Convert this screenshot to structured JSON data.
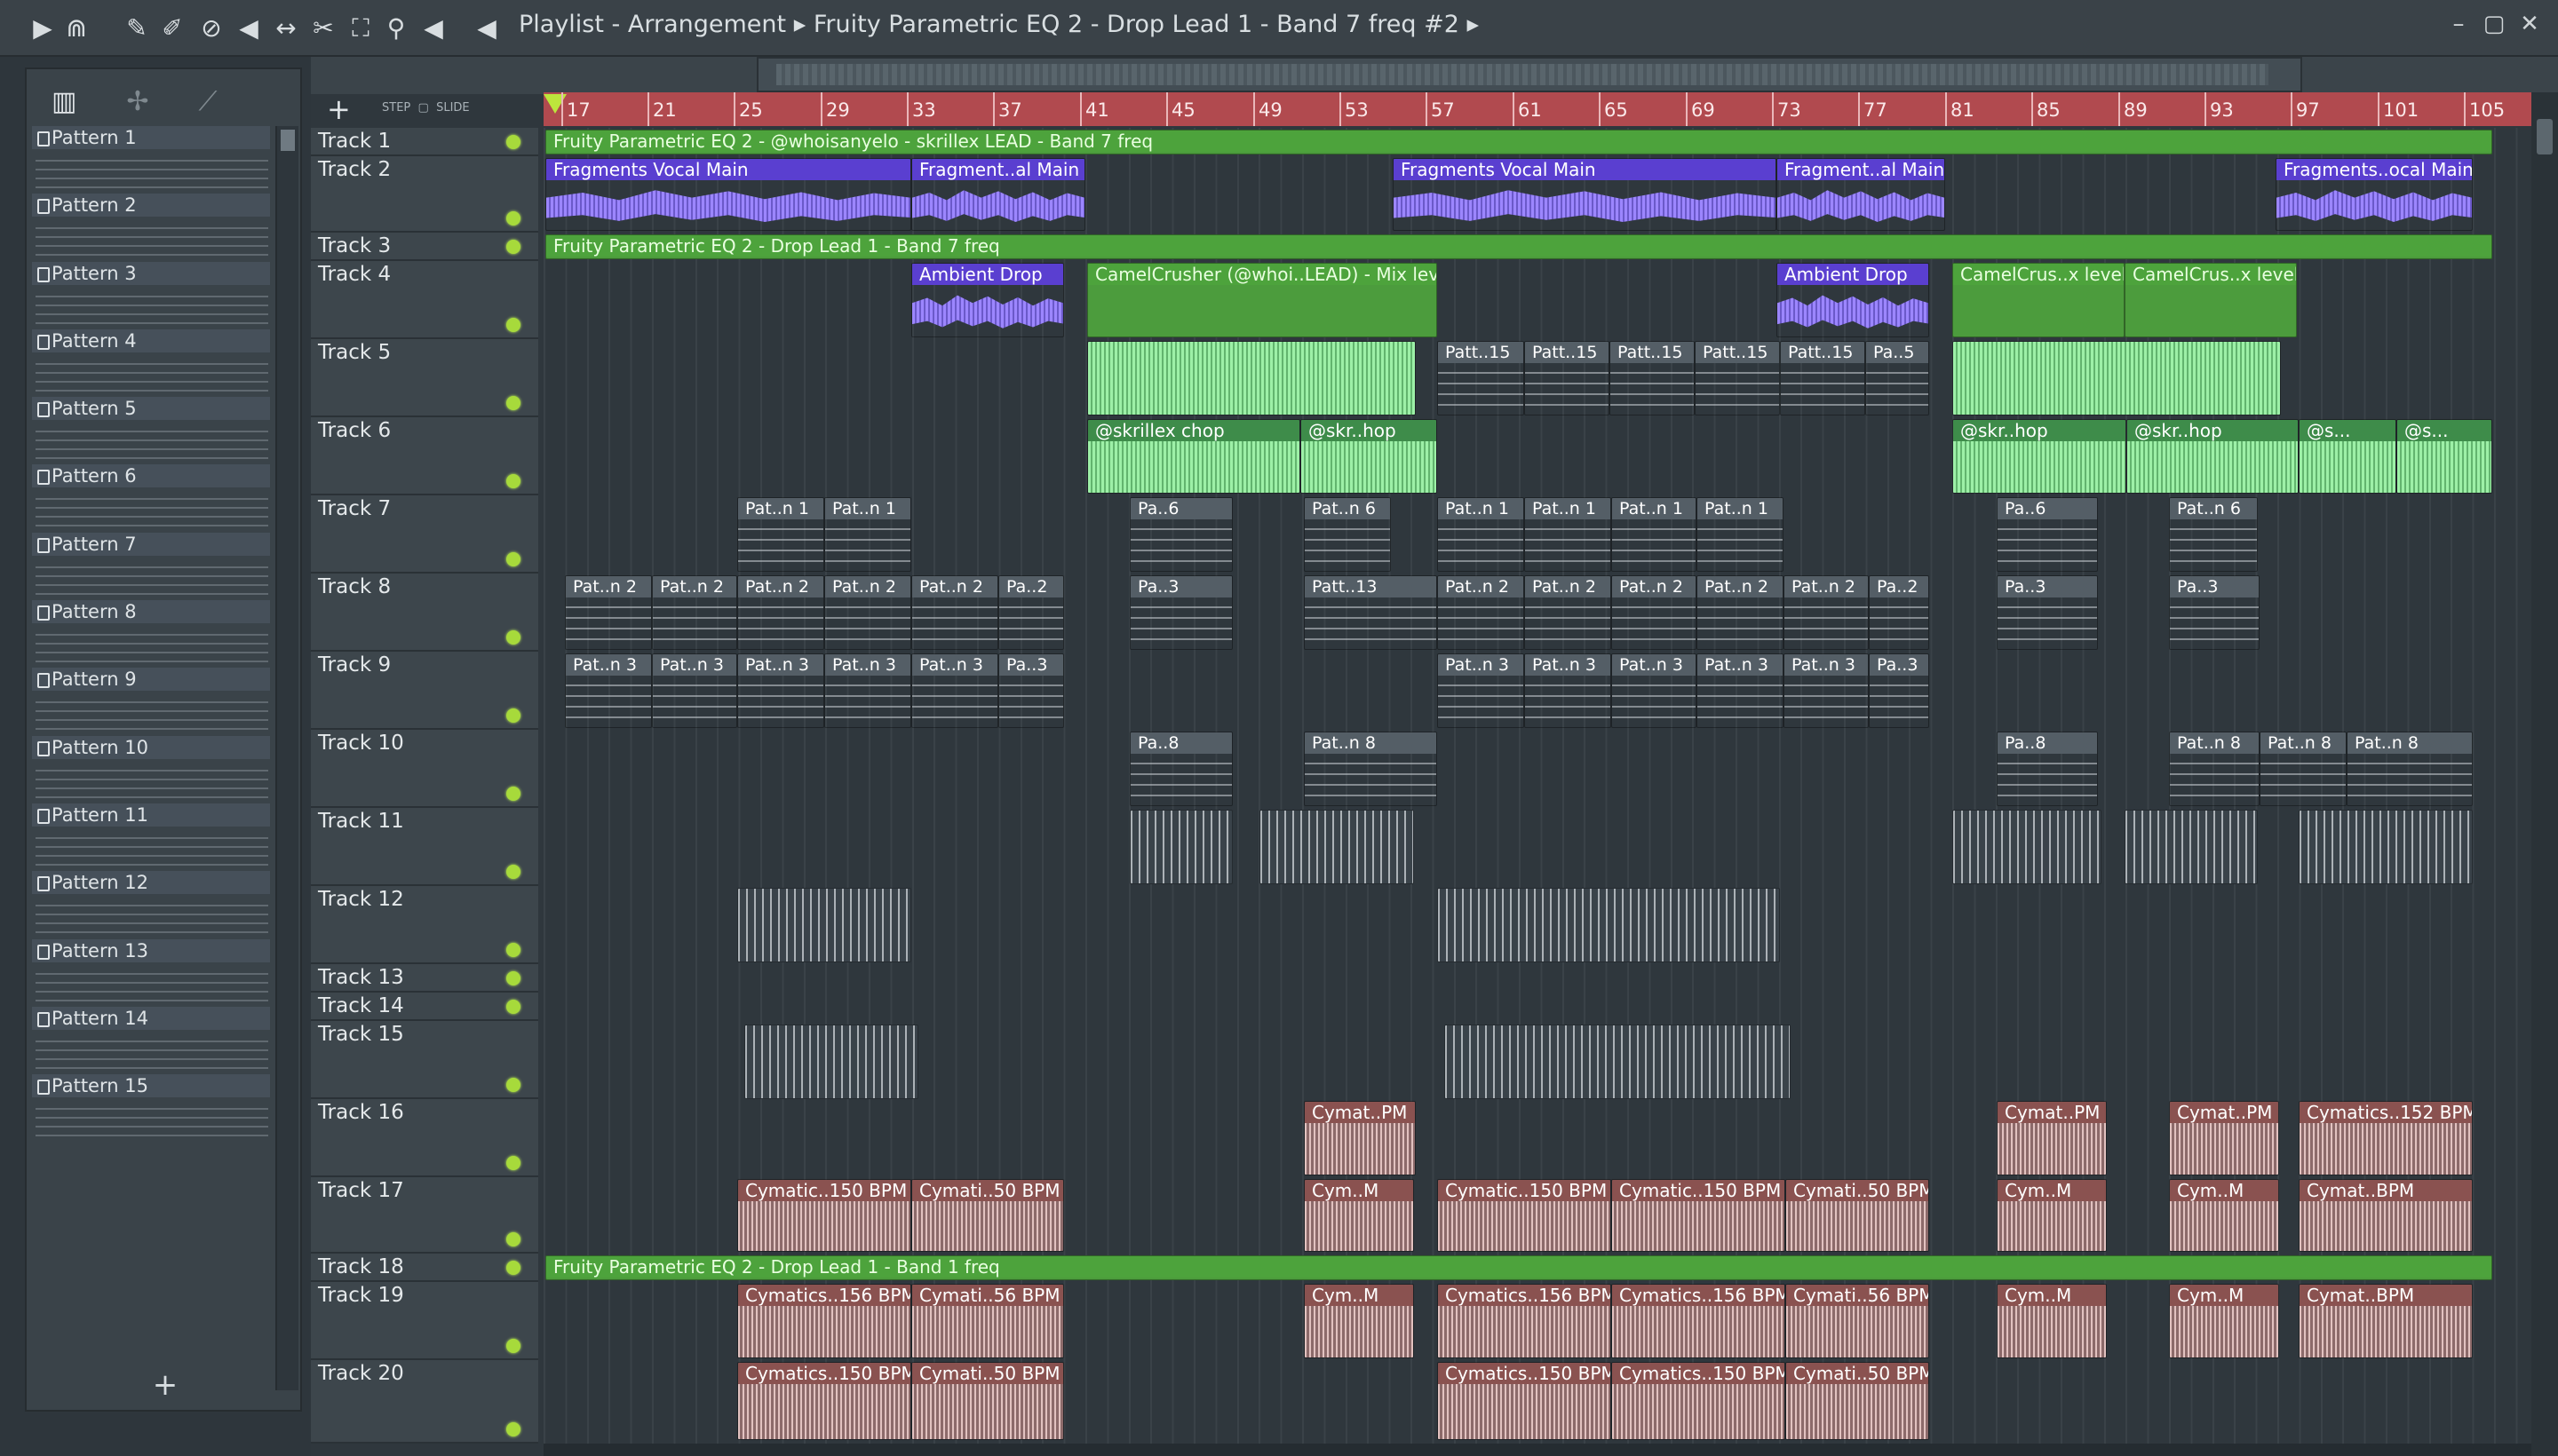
{
  "window": {
    "title": "Playlist - Arrangement",
    "breadcrumb": "Fruity Parametric EQ 2 - Drop Lead 1 - Band 7 freq #2",
    "controls": [
      "–",
      "▢",
      "✕"
    ]
  },
  "toolbar_icons": [
    "play-icon",
    "magnet-icon",
    "pencil-icon",
    "paint-icon",
    "delete-icon",
    "mute-icon",
    "slip-icon",
    "slice-icon",
    "select-icon",
    "zoom-icon",
    "playback-icon",
    "speaker-icon"
  ],
  "toolbar_glyphs": [
    "▶",
    "⋒",
    "✎",
    "✐",
    "⊘",
    "◀",
    "↔",
    "✂",
    "⛶",
    "⚲",
    "◀",
    "◀"
  ],
  "picker": {
    "add_label": "+",
    "head_icons": [
      "▥",
      "✢",
      "⟋"
    ],
    "patterns": [
      "Pattern 1",
      "Pattern 2",
      "Pattern 3",
      "Pattern 4",
      "Pattern 5",
      "Pattern 6",
      "Pattern 7",
      "Pattern 8",
      "Pattern 9",
      "Pattern 10",
      "Pattern 11",
      "Pattern 12",
      "Pattern 13",
      "Pattern 14",
      "Pattern 15"
    ]
  },
  "playlist": {
    "add_label": "+",
    "step_label": "STEP",
    "slide_label": "SLIDE",
    "ruler": [
      "17",
      "21",
      "25",
      "29",
      "33",
      "37",
      "41",
      "45",
      "49",
      "53",
      "57",
      "61",
      "65",
      "69",
      "73",
      "77",
      "81",
      "85",
      "89",
      "93",
      "97",
      "101",
      "105"
    ],
    "tracks": [
      "Track 1",
      "Track 2",
      "Track 3",
      "Track 4",
      "Track 5",
      "Track 6",
      "Track 7",
      "Track 8",
      "Track 9",
      "Track 10",
      "Track 11",
      "Track 12",
      "Track 13",
      "Track 14",
      "Track 15",
      "Track 16",
      "Track 17",
      "Track 18",
      "Track 19",
      "Track 20"
    ]
  },
  "clips": {
    "t1": "Fruity Parametric EQ 2 - @whoisanyelo - skrillex LEAD - Band 7 freq",
    "t2a": "Fragments Vocal Main",
    "t2b": "Fragment..al Main",
    "t2c": "Fragments Vocal Main",
    "t2d": "Fragment..al Main",
    "t2e": "Fragments..ocal Main",
    "t3": "Fruity Parametric EQ 2 - Drop Lead 1 - Band 7 freq",
    "t4a": "Ambient Drop",
    "t4b": "CamelCrusher (@whoi..LEAD) - Mix level",
    "t4c": "Ambient Drop",
    "t4d": "CamelCrus..x level",
    "t4e": "CamelCrus..x level",
    "t5": [
      "Patt..15",
      "Patt..15",
      "Patt..15",
      "Patt..15",
      "Patt..15",
      "Pa..5"
    ],
    "t6": [
      "@skrillex chop",
      "@skr..hop",
      "@skr..hop",
      "@skr..hop",
      "@s...",
      "@s..."
    ],
    "t7": [
      "Pat..n 1",
      "Pat..n 1",
      "Pa..6",
      "Pat..n 6",
      "Pat..n 1",
      "Pat..n 1",
      "Pat..n 1",
      "Pat..n 1",
      "Pa..6",
      "Pat..n 6"
    ],
    "t8": [
      "Pat..n 2",
      "Pat..n 2",
      "Pat..n 2",
      "Pat..n 2",
      "Pat..n 2",
      "Pa..2",
      "Pa..3",
      "Patt..13",
      "Pat..n 2",
      "Pat..n 2",
      "Pat..n 2",
      "Pat..n 2",
      "Pat..n 2",
      "Pa..2",
      "Pa..3",
      "Pa..3"
    ],
    "t9": [
      "Pat..n 3",
      "Pat..n 3",
      "Pat..n 3",
      "Pat..n 3",
      "Pat..n 3",
      "Pa..3",
      "Pat..n 3",
      "Pat..n 3",
      "Pat..n 3",
      "Pat..n 3",
      "Pat..n 3",
      "Pa..3"
    ],
    "t10": [
      "Pa..8",
      "Pat..n 8",
      "Pa..8",
      "Pat..n 8",
      "Pat..n 8",
      "Pat..n 8"
    ],
    "t16": [
      "Cymat..PM",
      "Cymat..PM",
      "Cymat..PM",
      "Cymatics..152 BPM"
    ],
    "t17": [
      "Cymatic..150 BPM",
      "Cymati..50 BPM",
      "Cym..M",
      "Cymatic..150 BPM",
      "Cymatic..150 BPM",
      "Cymati..50 BPM",
      "Cym..M",
      "Cym..M",
      "Cymat..BPM"
    ],
    "t18": "Fruity Parametric EQ 2 - Drop Lead 1 - Band 1 freq",
    "t19": [
      "Cymatics..156 BPM",
      "Cymati..56 BPM",
      "Cym..M",
      "Cymatics..156 BPM",
      "Cymatics..156 BPM",
      "Cymati..56 BPM",
      "Cym..M",
      "Cym..M",
      "Cymat..BPM"
    ],
    "t20": [
      "Cymatics..150 BPM",
      "Cymati..50 BPM",
      "Cymatics..150 BPM",
      "Cymatics..150 BPM",
      "Cymati..50 BPM"
    ]
  }
}
